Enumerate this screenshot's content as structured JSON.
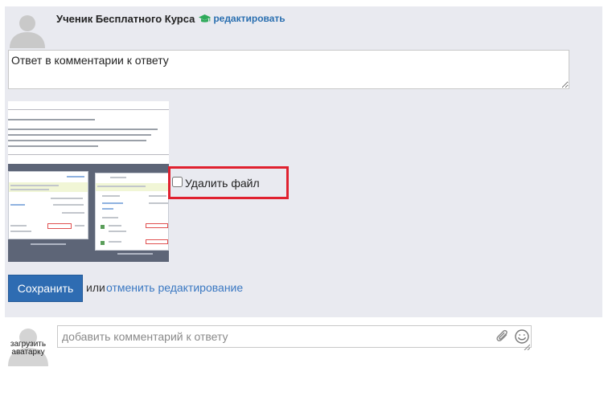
{
  "comment": {
    "author_name": "Ученик Бесплатного Курса",
    "edit_link": "редактировать",
    "text_value": "Ответ в комментарии к ответу"
  },
  "attachment": {
    "delete_label": "Удалить файл",
    "delete_checked": false
  },
  "actions": {
    "save_label": "Сохранить",
    "or_text": "или",
    "cancel_label": "отменить редактирование"
  },
  "new_comment": {
    "upload_avatar_label": "загрузить аватарку",
    "placeholder": "добавить комментарий к ответу"
  },
  "icons": {
    "author_badge": "graduation-cap-icon",
    "attach": "paperclip-icon",
    "emoji": "smiley-icon"
  },
  "colors": {
    "panel_bg": "#e9eaf0",
    "link_blue": "#2a6fb0",
    "save_button": "#2e6cb2",
    "highlight_red": "#e0212f",
    "badge_green": "#2eaa5a"
  }
}
